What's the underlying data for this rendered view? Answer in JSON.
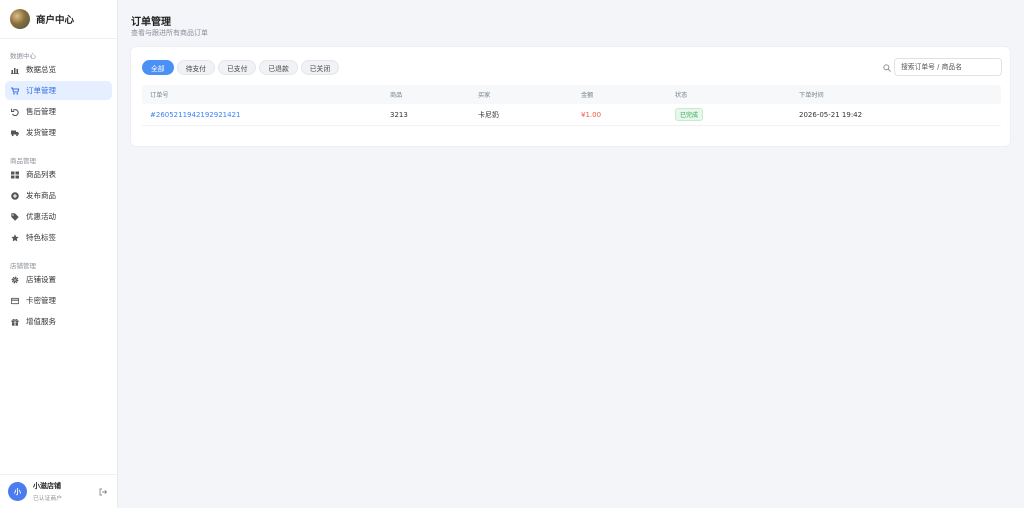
{
  "brand": {
    "title": "商户中心"
  },
  "sidebar": {
    "groups": [
      {
        "title": "数据中心",
        "items": [
          {
            "label": "数据总览",
            "icon": "bar-chart-icon"
          },
          {
            "label": "订单管理",
            "icon": "cart-icon",
            "active": true
          },
          {
            "label": "售后管理",
            "icon": "undo-icon"
          },
          {
            "label": "发货管理",
            "icon": "truck-icon"
          }
        ]
      },
      {
        "title": "商品管理",
        "items": [
          {
            "label": "商品列表",
            "icon": "grid-icon"
          },
          {
            "label": "发布商品",
            "icon": "plus-circle-icon"
          },
          {
            "label": "优惠活动",
            "icon": "tag-icon"
          },
          {
            "label": "特色标签",
            "icon": "star-icon"
          }
        ]
      },
      {
        "title": "店铺管理",
        "items": [
          {
            "label": "店铺设置",
            "icon": "gear-icon"
          },
          {
            "label": "卡密管理",
            "icon": "card-icon"
          },
          {
            "label": "增值服务",
            "icon": "gift-icon"
          }
        ]
      }
    ],
    "footer": {
      "avatar_letter": "小",
      "shop_name": "小滋店铺",
      "shop_status": "已认证商户"
    }
  },
  "header": {
    "title": "订单管理",
    "subtitle": "查看与跟进所有商品订单"
  },
  "tabs": [
    {
      "label": "全部",
      "active": true
    },
    {
      "label": "待支付"
    },
    {
      "label": "已支付"
    },
    {
      "label": "已退款"
    },
    {
      "label": "已关闭"
    }
  ],
  "search": {
    "placeholder": "搜索订单号 / 商品名"
  },
  "table": {
    "columns": [
      "订单号",
      "商品",
      "买家",
      "金额",
      "状态",
      "下单时间"
    ],
    "rows": [
      {
        "order_no": "#2605211942192921421",
        "product": "3213",
        "buyer": "卡尼奶",
        "amount": "¥1.00",
        "status": "已完成",
        "time": "2026-05-21 19:42"
      }
    ]
  },
  "colors": {
    "accent": "#4a90f7",
    "active_nav_bg": "#e6efff",
    "amount": "#f05a4a",
    "status_ok": "#2ea84a"
  }
}
